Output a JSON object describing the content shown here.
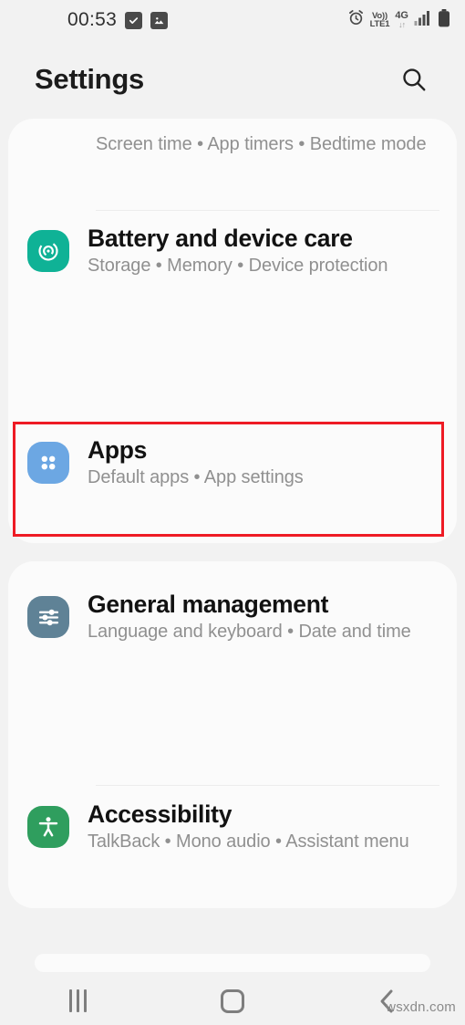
{
  "status_bar": {
    "time": "00:53",
    "left_icons": [
      "checkbox-checked-icon",
      "image-icon"
    ],
    "right_icons": [
      "alarm-icon",
      "volte-icon",
      "4g-icon",
      "signal-bars-icon",
      "battery-icon"
    ],
    "volte_top": "Vo))",
    "volte_bottom": "LTE1",
    "network": "4G",
    "data_arrows": "↓↑"
  },
  "header": {
    "title": "Settings",
    "search_icon": "search-icon"
  },
  "cards": [
    {
      "id": "card-one",
      "rows": [
        {
          "id": "digital-wellbeing",
          "title": "",
          "subtitle": "Screen time  •  App timers  •  Bedtime mode",
          "icon": "",
          "icon_color": "",
          "clipped": true,
          "highlighted": false
        },
        {
          "id": "battery-and-device-care",
          "title": "Battery and device care",
          "subtitle": "Storage  •  Memory  •  Device protection",
          "icon": "device-care-icon",
          "icon_color": "#0fb296",
          "clipped": false,
          "highlighted": false
        },
        {
          "id": "apps",
          "title": "Apps",
          "subtitle": "Default apps  •  App settings",
          "icon": "apps-grid-icon",
          "icon_color": "#6ca7e3",
          "clipped": false,
          "highlighted": true
        }
      ]
    },
    {
      "id": "card-two",
      "rows": [
        {
          "id": "general-management",
          "title": "General management",
          "subtitle": "Language and keyboard  •  Date and time",
          "icon": "sliders-icon",
          "icon_color": "#5f8296",
          "clipped": false,
          "highlighted": false
        },
        {
          "id": "accessibility",
          "title": "Accessibility",
          "subtitle": "TalkBack  •  Mono audio  •  Assistant menu",
          "icon": "accessibility-person-icon",
          "icon_color": "#2f9e5e",
          "clipped": false,
          "highlighted": false
        }
      ]
    }
  ],
  "annotation": {
    "color": "#ee1b24",
    "target": "apps"
  },
  "nav_bar": {
    "recents_label": "recents-icon",
    "home_label": "home-icon",
    "back_label": "back-icon"
  },
  "watermark": "wsxdn.com"
}
